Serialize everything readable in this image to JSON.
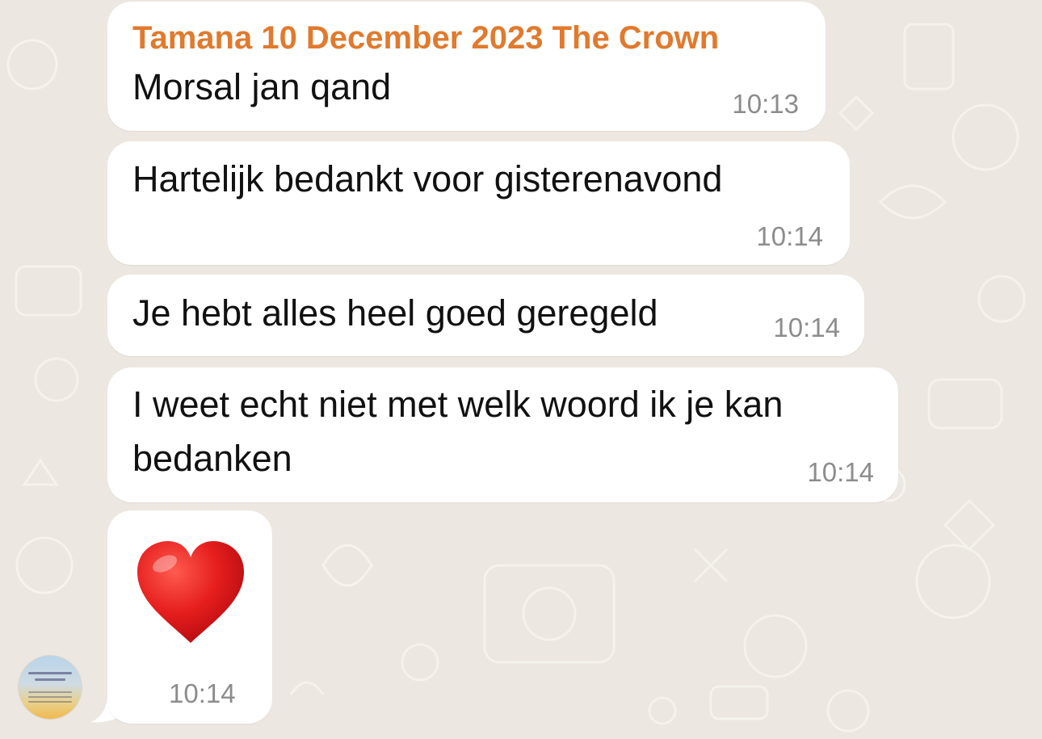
{
  "chat": {
    "sender": "Tamana 10 December 2023 The Crown",
    "messages": [
      {
        "text": "Morsal jan qand",
        "time": "10:13"
      },
      {
        "text": "Hartelijk bedankt voor gisterenavond",
        "time": "10:14"
      },
      {
        "text": "Je hebt alles heel goed geregeld",
        "time": "10:14"
      },
      {
        "lines": [
          "I weet echt niet met welk woord ik je kan",
          "bedanken"
        ],
        "time": "10:14"
      },
      {
        "emoji": "❤️",
        "time": "10:14"
      }
    ]
  },
  "colors": {
    "sender_name": "#e07a2e",
    "bubble": "#ffffff",
    "background": "#ece7e0",
    "timestamp": "#8c8c8c"
  },
  "icons": [
    "heart-emoji",
    "avatar"
  ]
}
